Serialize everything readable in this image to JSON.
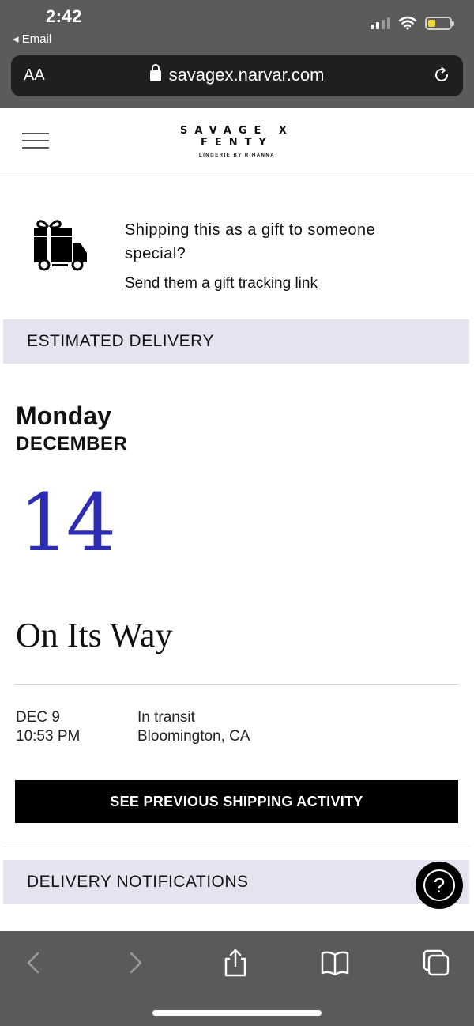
{
  "status_bar": {
    "time": "2:42",
    "back_label": "◂ Email"
  },
  "browser": {
    "text_size_label": "AA",
    "url": "savagex.narvar.com"
  },
  "brand": {
    "name": "SAVAGE X FENTY",
    "tagline": "LINGERIE BY RIHANNA"
  },
  "gift_promo": {
    "message": "Shipping this as a gift to someone special?",
    "link_label": "Send them a gift tracking link"
  },
  "estimated_delivery": {
    "section_label": "ESTIMATED DELIVERY",
    "weekday": "Monday",
    "month": "DECEMBER",
    "day": "14",
    "status": "On Its Way",
    "latest_event": {
      "date": "DEC 9",
      "time": "10:53 PM",
      "status": "In transit",
      "location": "Bloomington, CA"
    },
    "activity_button_label": "SEE PREVIOUS SHIPPING ACTIVITY"
  },
  "notifications": {
    "section_label": "DELIVERY NOTIFICATIONS"
  },
  "help_button": {
    "label": "?"
  },
  "colors": {
    "accent_date": "#2d2db3",
    "section_band": "#e4e4f1",
    "chrome": "#5a5a5a",
    "button_bg": "#000000"
  },
  "icons": {
    "gift": "gift-truck-icon",
    "lock": "lock-icon",
    "reload": "reload-icon",
    "menu": "hamburger-icon",
    "help": "question-icon"
  }
}
